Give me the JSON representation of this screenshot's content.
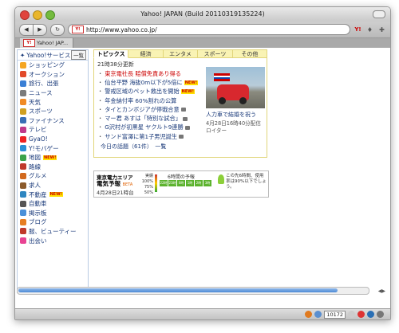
{
  "window": {
    "title": "Yahoo! JAPAN (Build 20110319135224)"
  },
  "toolbar": {
    "back_icon": "back-arrow-icon",
    "forward_icon": "forward-arrow-icon",
    "reload_icon": "reload-icon",
    "url": "http://www.yahoo.co.jp/",
    "favicon": "Y!",
    "search_logo": "Y!"
  },
  "tab": {
    "label": "Yahoo! JAP...",
    "favicon": "Y!"
  },
  "sidebar": {
    "header": "Yahoo!サービス",
    "all_button": "一覧",
    "new_badge": "NEW!",
    "items": [
      {
        "label": "ショッピング",
        "color": "#f5a623"
      },
      {
        "label": "オークション",
        "color": "#e24a2a"
      },
      {
        "label": "旅行、出張",
        "color": "#3a7fd5"
      },
      {
        "label": "ニュース",
        "color": "#7a7a7a"
      },
      {
        "label": "天気",
        "color": "#f08a24"
      },
      {
        "label": "スポーツ",
        "color": "#d0a020"
      },
      {
        "label": "ファイナンス",
        "color": "#3a6fb5"
      },
      {
        "label": "テレビ",
        "color": "#c03a8a"
      },
      {
        "label": "GyaO!",
        "color": "#e22"
      },
      {
        "label": "Y!モバゲー",
        "color": "#2a8fd5"
      },
      {
        "label": "地図",
        "color": "#3aa34a",
        "new": true
      },
      {
        "label": "路線",
        "color": "#c0392b"
      },
      {
        "label": "グルメ",
        "color": "#d2691e"
      },
      {
        "label": "求人",
        "color": "#8b5a2b"
      },
      {
        "label": "不動産",
        "color": "#2e86c1",
        "new": true
      },
      {
        "label": "自動車",
        "color": "#555555"
      },
      {
        "label": "掲示板",
        "color": "#4a90d9"
      },
      {
        "label": "ブログ",
        "color": "#e67e22"
      },
      {
        "label": "服、ビューティー",
        "color": "#c0392b"
      },
      {
        "label": "出会い",
        "color": "#e84393"
      }
    ]
  },
  "main": {
    "tabs": [
      "トピックス",
      "経済",
      "エンタメ",
      "スポーツ",
      "その他"
    ],
    "updated": "21時38分更新",
    "topics": [
      {
        "text": "東京電社長 賠償免責あり得る",
        "hot": true
      },
      {
        "text": "仙台平野 海抜0m以下が5倍に",
        "new": true
      },
      {
        "text": "警戒区域のペット救出を開始",
        "new": true
      },
      {
        "text": "年金納付率 60%割れの公算"
      },
      {
        "text": "タイとカンボジアが停戦合意",
        "photo": true
      },
      {
        "text": "マー君 あすは「特別な試合」",
        "photo": true
      },
      {
        "text": "G沢村が初黒星 ヤクルト9連勝",
        "photo": true
      },
      {
        "text": "サンド富澤に第1子男児誕生",
        "photo": true
      }
    ],
    "today": "今日の話題（61件）　一覧",
    "photo_caption": "人力車で結婚を祝う",
    "photo_meta": "4月28日16時40分配信　ロイター"
  },
  "power": {
    "region": "東京電力エリア",
    "name": "電気予報",
    "beta": "BETA",
    "date": "4月28日21時台",
    "scale": [
      "実績",
      "100%",
      "75%",
      "50%"
    ],
    "forecast_title": "6時間の予報",
    "bars": [
      {
        "label": "",
        "filled": false
      },
      {
        "label": "",
        "filled": false
      },
      {
        "label": "",
        "filled": false
      },
      {
        "label": "",
        "filled": false
      },
      {
        "label": "",
        "filled": false
      },
      {
        "label": "",
        "filled": false
      },
      {
        "label": "",
        "filled": false
      }
    ],
    "bar_labels": [
      "22時",
      "23時",
      "0時",
      "1時",
      "2時",
      "3時"
    ],
    "message": "この先6時間、使用率は90%以下でしょう。"
  },
  "statusbar": {
    "count": "10172"
  }
}
